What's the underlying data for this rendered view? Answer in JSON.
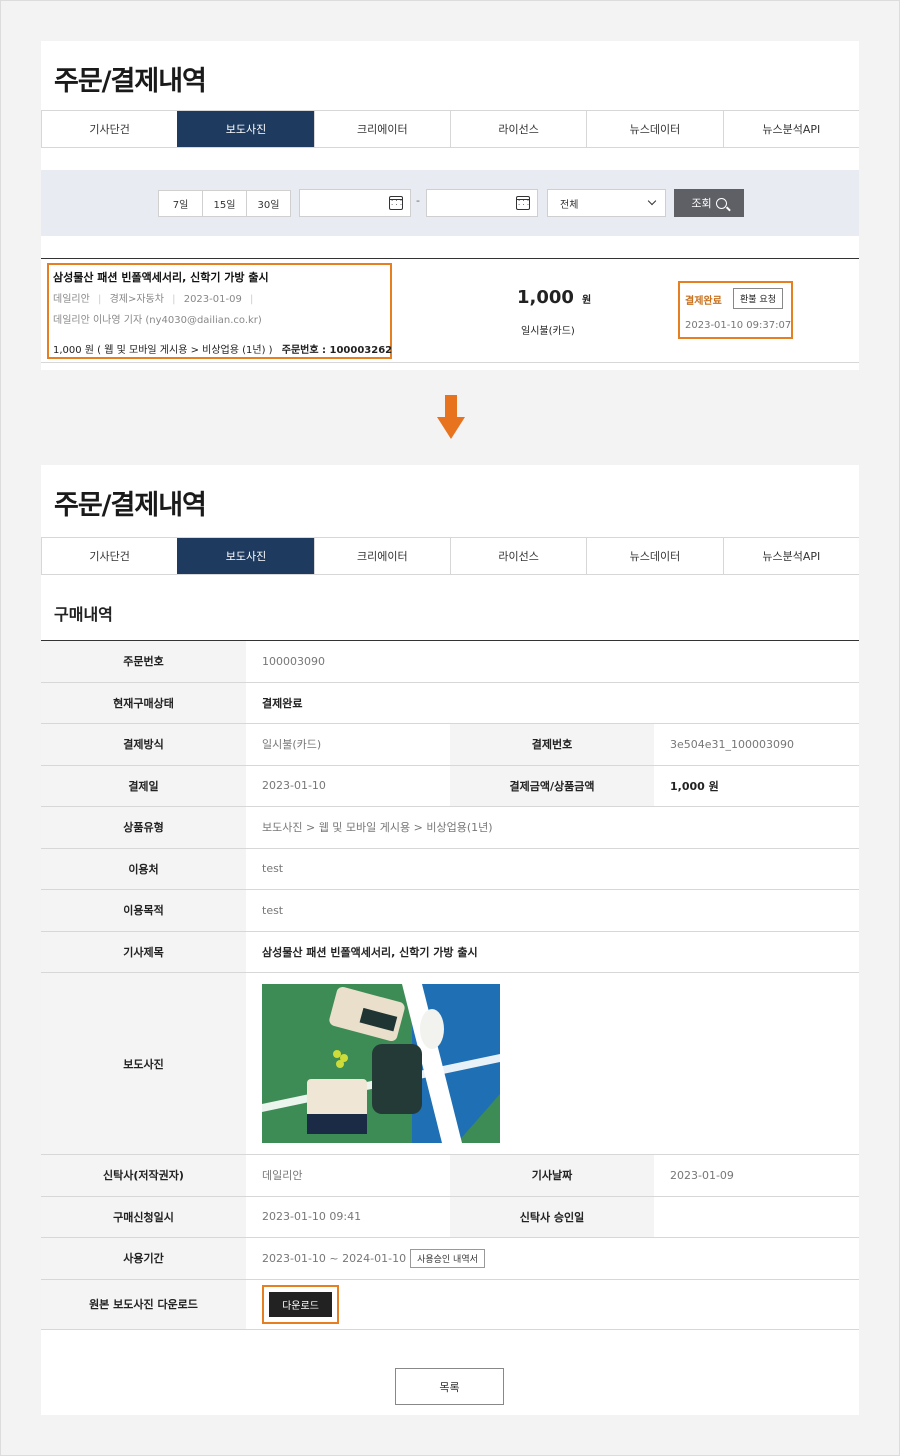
{
  "top": {
    "title": "주문/결제내역",
    "tabs": [
      "기사단건",
      "보도사진",
      "크리에이터",
      "라이선스",
      "뉴스데이터",
      "뉴스분석API"
    ],
    "filters": {
      "periods": [
        "7일",
        "15일",
        "30일"
      ],
      "date_separator": "-",
      "select_value": "전체",
      "search_label": "조회"
    },
    "order": {
      "title": "삼성물산 패션 빈폴액세서리, 신학기 가방 출시",
      "source": "데일리안",
      "category": "경제>자동차",
      "date": "2023-01-09",
      "reporter": "데일리안 이나영 기자 (ny4030@dailian.co.kr)",
      "product": "1,000 원 ( 웹 및 모바일 게시용 > 비상업용 (1년) )",
      "order_no_label": "주문번호 : 100003262",
      "price": "1,000",
      "currency": "원",
      "pay_method": "일시불(카드)",
      "status": "결제완료",
      "refund_label": "환불 요청",
      "paid_at": "2023-01-10 09:37:07"
    }
  },
  "bottom": {
    "title": "주문/결제내역",
    "tabs": [
      "기사단건",
      "보도사진",
      "크리에이터",
      "라이선스",
      "뉴스데이터",
      "뉴스분석API"
    ],
    "section_title": "구매내역",
    "rows": {
      "order_no": {
        "label": "주문번호",
        "value": "100003090"
      },
      "status": {
        "label": "현재구매상태",
        "value": "결제완료"
      },
      "pay_method": {
        "label": "결제방식",
        "value": "일시불(카드)",
        "label2": "결제번호",
        "value2": "3e504e31_100003090"
      },
      "pay_date": {
        "label": "결제일",
        "value": "2023-01-10",
        "label2": "결제금액/상품금액",
        "value2": "1,000 원"
      },
      "product_type": {
        "label": "상품유형",
        "value": "보도사진 > 웹 및 모바일 게시용 > 비상업용(1년)"
      },
      "usage_place": {
        "label": "이용처",
        "value": "test"
      },
      "usage_purpose": {
        "label": "이용목적",
        "value": "test"
      },
      "article_title": {
        "label": "기사제목",
        "value": "삼성물산 패션 빈폴액세서리, 신학기 가방 출시"
      },
      "photo": {
        "label": "보도사진"
      },
      "trustee": {
        "label": "신탁사(저작권자)",
        "value": "데일리안",
        "label2": "기사날짜",
        "value2": "2023-01-09"
      },
      "request_date": {
        "label": "구매신청일시",
        "value": "2023-01-10 09:41",
        "label2": "신탁사 승인일",
        "value2": ""
      },
      "period": {
        "label": "사용기간",
        "value": "2023-01-10 ~ 2024-01-10",
        "button": "사용승인 내역서"
      },
      "download": {
        "label": "원본 보도사진 다운로드",
        "button": "다운로드"
      }
    },
    "list_button": "목록"
  },
  "colors": {
    "accent": "#e67e22",
    "navy": "#1e3a5f",
    "dark_button": "#5e6066"
  }
}
